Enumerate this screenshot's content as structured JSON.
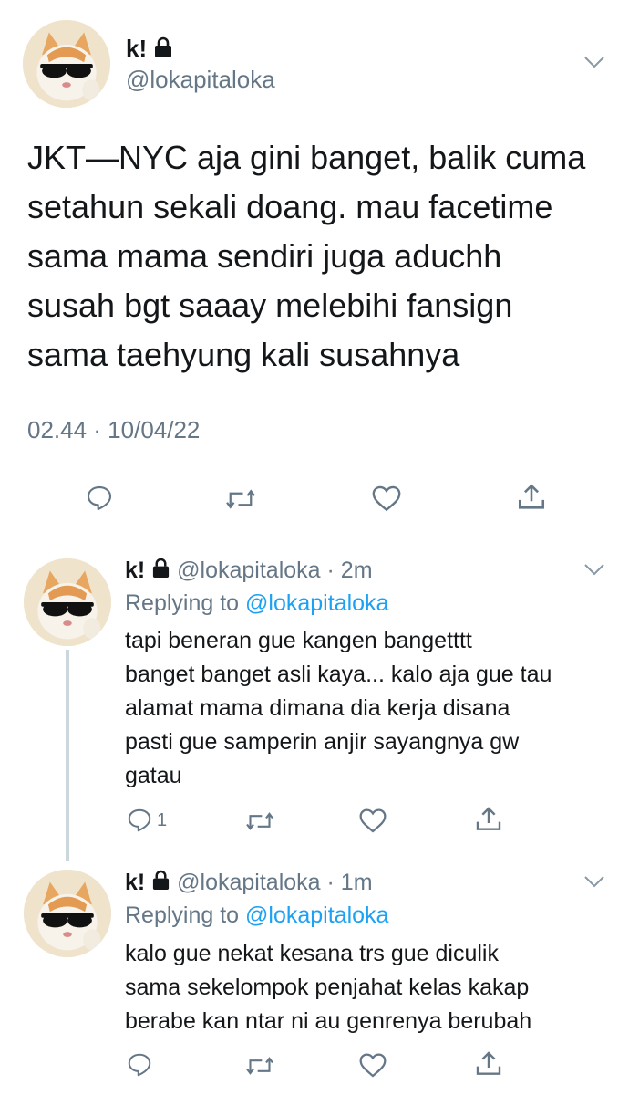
{
  "main_tweet": {
    "name": "k!",
    "handle": "@lokapitaloka",
    "text_lines": [
      "JKT—NYC aja gini banget, balik cuma",
      "setahun sekali doang. mau facetime",
      "sama mama sendiri juga aduchh",
      "susah bgt saaay melebihi fansign",
      "sama taehyung kali susahnya"
    ],
    "timestamp": "02.44 · 10/04/22",
    "icons": [
      "reply-icon",
      "retweet-icon",
      "like-icon",
      "share-icon"
    ]
  },
  "replies": [
    {
      "name": "k!",
      "handle": "@lokapitaloka",
      "time": "· 2m",
      "replying_label": "Replying to",
      "replying_to": "@lokapitaloka",
      "text_lines": [
        "tapi beneran gue kangen bangetttt",
        "banget banget asli kaya... kalo aja gue tau",
        "alamat mama dimana dia kerja disana",
        "pasti gue samperin anjir sayangnya gw",
        "gatau"
      ],
      "reply_count": "1"
    },
    {
      "name": "k!",
      "handle": "@lokapitaloka",
      "time": "· 1m",
      "replying_label": "Replying to",
      "replying_to": "@lokapitaloka",
      "text_lines": [
        "kalo gue nekat kesana trs gue diculik",
        "sama sekelompok penjahat kelas kakap",
        "berabe kan ntar ni au genrenya berubah"
      ],
      "reply_count": ""
    }
  ],
  "colors": {
    "text": "#14171a",
    "muted": "#657786",
    "link": "#1da1f2",
    "divider": "#e1e8ed",
    "thread_line": "#ccd6dd"
  }
}
